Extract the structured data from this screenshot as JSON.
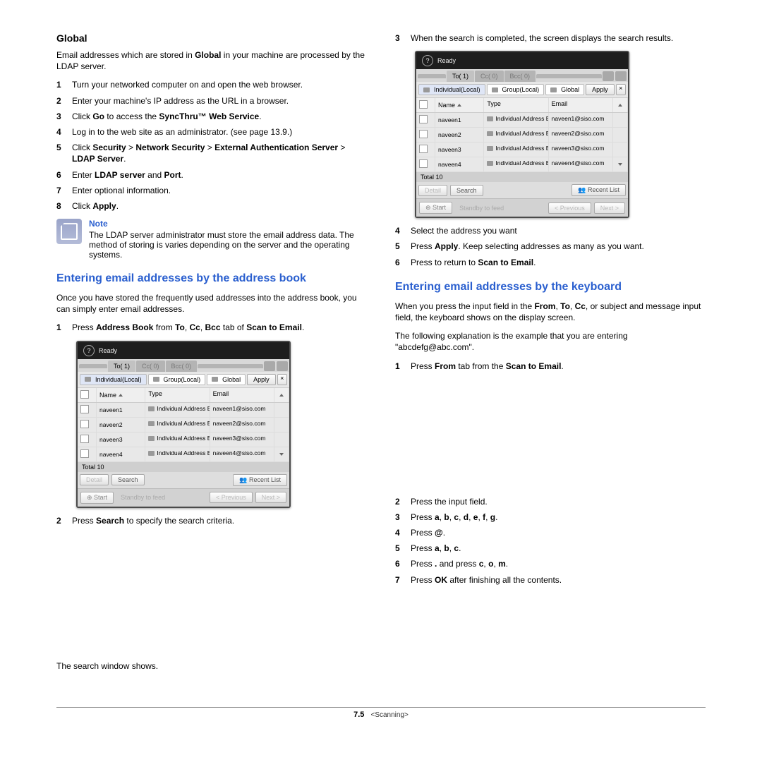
{
  "left": {
    "global_heading": "Global",
    "global_para_a": "Email addresses which are stored in ",
    "global_bold": "Global",
    "global_para_b": " in your machine are processed by the LDAP server.",
    "steps": [
      {
        "n": "1",
        "parts": [
          {
            "t": "Turn your networked computer on and open the web browser."
          }
        ]
      },
      {
        "n": "2",
        "parts": [
          {
            "t": "Enter your machine's IP address as the URL in a browser."
          }
        ]
      },
      {
        "n": "3",
        "parts": [
          {
            "t": "Click "
          },
          {
            "b": "Go"
          },
          {
            "t": " to access the "
          },
          {
            "b": "SyncThru™ Web Service"
          },
          {
            "t": "."
          }
        ]
      },
      {
        "n": "4",
        "parts": [
          {
            "t": "Log in to the web site as an administrator. (see  page 13.9.)"
          }
        ]
      },
      {
        "n": "5",
        "parts": [
          {
            "t": "Click "
          },
          {
            "b": "Security"
          },
          {
            "t": " > "
          },
          {
            "b": "Network Security"
          },
          {
            "t": " > "
          },
          {
            "b": "External Authentication Server"
          },
          {
            "t": " > "
          },
          {
            "b": "LDAP Server"
          },
          {
            "t": "."
          }
        ]
      },
      {
        "n": "6",
        "parts": [
          {
            "t": "Enter "
          },
          {
            "b": "LDAP server"
          },
          {
            "t": " and "
          },
          {
            "b": "Port"
          },
          {
            "t": "."
          }
        ]
      },
      {
        "n": "7",
        "parts": [
          {
            "t": "Enter optional information."
          }
        ]
      },
      {
        "n": "8",
        "parts": [
          {
            "t": "Click "
          },
          {
            "b": "Apply"
          },
          {
            "t": "."
          }
        ]
      }
    ],
    "note_title": "Note",
    "note_body": "The LDAP server administrator must store the email address data. The method of storing is varies depending on the server and the operating systems.",
    "sec2_heading": "Entering email addresses by the address book",
    "sec2_intro": "Once you have stored the frequently used addresses into the address book, you can simply enter email addresses.",
    "sec2_steps_a": [
      {
        "n": "1",
        "parts": [
          {
            "t": "Press "
          },
          {
            "b": "Address Book"
          },
          {
            "t": " from "
          },
          {
            "b": "To"
          },
          {
            "t": ", "
          },
          {
            "b": "Cc"
          },
          {
            "t": ", "
          },
          {
            "b": "Bcc"
          },
          {
            "t": " tab of "
          },
          {
            "b": "Scan to Email"
          },
          {
            "t": "."
          }
        ]
      }
    ],
    "sec2_steps_b": [
      {
        "n": "2",
        "parts": [
          {
            "t": "Press "
          },
          {
            "b": "Search"
          },
          {
            "t": " to specify the search criteria."
          }
        ]
      }
    ],
    "sec2_tail": "The search window shows."
  },
  "right": {
    "steps_a": [
      {
        "n": "3",
        "parts": [
          {
            "t": "When the search is completed, the screen displays the search results."
          }
        ]
      }
    ],
    "steps_b": [
      {
        "n": "4",
        "parts": [
          {
            "t": "Select the address you want"
          }
        ]
      },
      {
        "n": "5",
        "parts": [
          {
            "t": "Press "
          },
          {
            "b": "Apply"
          },
          {
            "t": ". Keep selecting addresses as many as you want."
          }
        ]
      },
      {
        "n": "6",
        "parts": [
          {
            "t": "Press       to return to "
          },
          {
            "b": "Scan to Email"
          },
          {
            "t": "."
          }
        ]
      }
    ],
    "sec3_heading": "Entering email addresses by the keyboard",
    "sec3_p1_a": "When you press the input field in the ",
    "sec3_p1_parts": [
      {
        "b": "From"
      },
      {
        "t": ", "
      },
      {
        "b": "To"
      },
      {
        "t": ", "
      },
      {
        "b": "Cc"
      }
    ],
    "sec3_p1_b": ", or subject and message input field, the keyboard shows on the display screen.",
    "sec3_p2": "The following explanation is the example that you are entering \"abcdefg@abc.com\".",
    "sec3_steps_a": [
      {
        "n": "1",
        "parts": [
          {
            "t": "Press "
          },
          {
            "b": "From"
          },
          {
            "t": " tab from the "
          },
          {
            "b": "Scan to Email"
          },
          {
            "t": "."
          }
        ]
      }
    ],
    "sec3_steps_b": [
      {
        "n": "2",
        "parts": [
          {
            "t": "Press the input field."
          }
        ]
      },
      {
        "n": "3",
        "parts": [
          {
            "t": "Press "
          },
          {
            "b": "a"
          },
          {
            "t": ", "
          },
          {
            "b": "b"
          },
          {
            "t": ", "
          },
          {
            "b": "c"
          },
          {
            "t": ", "
          },
          {
            "b": "d"
          },
          {
            "t": ", "
          },
          {
            "b": "e"
          },
          {
            "t": ", "
          },
          {
            "b": "f"
          },
          {
            "t": ", "
          },
          {
            "b": "g"
          },
          {
            "t": "."
          }
        ]
      },
      {
        "n": "4",
        "parts": [
          {
            "t": "Press "
          },
          {
            "b": "@"
          },
          {
            "t": "."
          }
        ]
      },
      {
        "n": "5",
        "parts": [
          {
            "t": "Press "
          },
          {
            "b": "a"
          },
          {
            "t": ", "
          },
          {
            "b": "b"
          },
          {
            "t": ", "
          },
          {
            "b": "c"
          },
          {
            "t": "."
          }
        ]
      },
      {
        "n": "6",
        "parts": [
          {
            "t": "Press "
          },
          {
            "b": "."
          },
          {
            "t": " and press "
          },
          {
            "b": "c"
          },
          {
            "t": ", "
          },
          {
            "b": "o"
          },
          {
            "t": ", "
          },
          {
            "b": "m"
          },
          {
            "t": "."
          }
        ]
      },
      {
        "n": "7",
        "parts": [
          {
            "t": "Press "
          },
          {
            "b": "OK"
          },
          {
            "t": " after finishing all the contents."
          }
        ]
      }
    ]
  },
  "shot": {
    "ready": "Ready",
    "tabs": [
      "To( 1)",
      "Cc( 0)",
      "Bcc( 0)"
    ],
    "filters": {
      "ind": "Individual(Local)",
      "grp": "Group(Local)",
      "glob": "Global",
      "apply": "Apply"
    },
    "head": {
      "name": "Name",
      "type": "Type",
      "email": "Email"
    },
    "rows": [
      {
        "name": "naveen1",
        "type": "Individual Address Book",
        "email": "naveen1@siso.com"
      },
      {
        "name": "naveen2",
        "type": "Individual Address Book",
        "email": "naveen2@siso.com"
      },
      {
        "name": "naveen3",
        "type": "Individual Address Book",
        "email": "naveen3@siso.com"
      },
      {
        "name": "naveen4",
        "type": "Individual Address Book",
        "email": "naveen4@siso.com"
      }
    ],
    "total": "Total 10",
    "detail": "Detail",
    "search": "Search",
    "recent": "Recent List",
    "start": "Start",
    "standby": "Standby to feed",
    "prev": "< Previous",
    "next": "Next >"
  },
  "footer": {
    "page": "7.5",
    "section": "<Scanning>"
  }
}
